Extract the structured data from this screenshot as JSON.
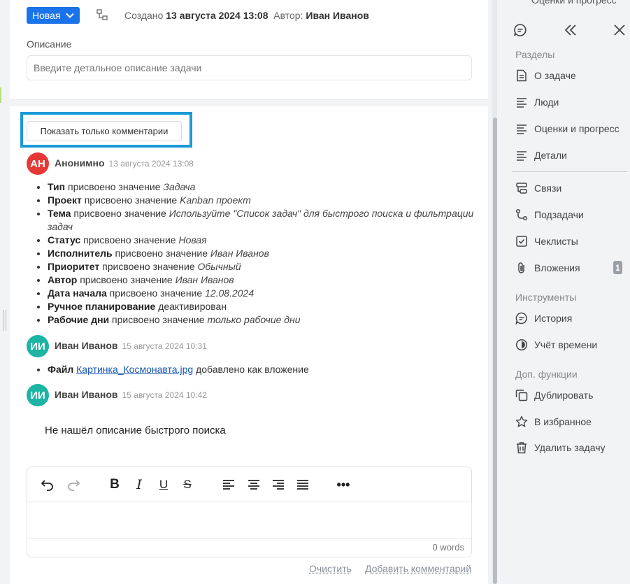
{
  "task": {
    "status_label": "Новая",
    "created_prefix": "Создано",
    "created_date": "13 августа 2024 13:08",
    "author_prefix": "Автор:",
    "author_name": "Иван Иванов"
  },
  "description": {
    "label": "Описание",
    "placeholder": "Введите детальное описание задачи"
  },
  "filter": {
    "label": "Показать только комментарии"
  },
  "history": [
    {
      "initials": "АН",
      "avatar_color": "#e53935",
      "author": "Анонимно",
      "timestamp": "13 августа 2024 13:08",
      "changes": [
        {
          "field": "Тип",
          "action": "присвоено значение",
          "value": "Задача"
        },
        {
          "field": "Проект",
          "action": "присвоено значение",
          "value": "Kanban проект"
        },
        {
          "field": "Тема",
          "action": "присвоено значение",
          "value": "Используйте \"Список задач\" для быстрого поиска и фильтрации задач"
        },
        {
          "field": "Статус",
          "action": "присвоено значение",
          "value": "Новая"
        },
        {
          "field": "Исполнитель",
          "action": "присвоено значение",
          "value": "Иван Иванов"
        },
        {
          "field": "Приоритет",
          "action": "присвоено значение",
          "value": "Обычный"
        },
        {
          "field": "Автор",
          "action": "присвоено значение",
          "value": "Иван Иванов"
        },
        {
          "field": "Дата начала",
          "action": "присвоено значение",
          "value": "12.08.2024"
        },
        {
          "field": "Ручное планирование",
          "action": "деактивирован",
          "value": ""
        },
        {
          "field": "Рабочие дни",
          "action": "присвоено значение",
          "value": "только рабочие дни"
        }
      ]
    },
    {
      "initials": "ИИ",
      "avatar_color": "#1cb5a3",
      "author": "Иван Иванов",
      "timestamp": "15 августа 2024 10:31",
      "file_field": "Файл",
      "file_name": "Картинка_Космонавта.jpg",
      "file_action": "добавлено как вложение"
    },
    {
      "initials": "ИИ",
      "avatar_color": "#1cb5a3",
      "author": "Иван Иванов",
      "timestamp": "15 августа 2024 10:42",
      "comment": "Не нашёл описание быстрого поиска"
    }
  ],
  "editor": {
    "word_count": "0 words",
    "clear_label": "Очистить",
    "add_label": "Добавить комментарий"
  },
  "sidebar": {
    "partial_top_label": "Оценки и прогресс",
    "sections_title": "Разделы",
    "sections": [
      {
        "label": "О задаче",
        "icon": "document-icon"
      },
      {
        "label": "Люди",
        "icon": "lines-icon"
      },
      {
        "label": "Оценки и прогресс",
        "icon": "lines-icon"
      },
      {
        "label": "Детали",
        "icon": "lines-icon"
      }
    ],
    "links": [
      {
        "label": "Связи",
        "icon": "links-icon"
      },
      {
        "label": "Подзадачи",
        "icon": "subtasks-icon"
      },
      {
        "label": "Чеклисты",
        "icon": "checklist-icon"
      },
      {
        "label": "Вложения",
        "icon": "paperclip-icon",
        "badge": "1"
      }
    ],
    "tools_title": "Инструменты",
    "tools": [
      {
        "label": "История",
        "icon": "history-icon"
      },
      {
        "label": "Учёт времени",
        "icon": "timer-icon"
      }
    ],
    "extra_title": "Доп. функции",
    "extra": [
      {
        "label": "Дублировать",
        "icon": "duplicate-icon"
      },
      {
        "label": "В избранное",
        "icon": "star-icon"
      },
      {
        "label": "Удалить задачу",
        "icon": "trash-icon"
      }
    ]
  }
}
